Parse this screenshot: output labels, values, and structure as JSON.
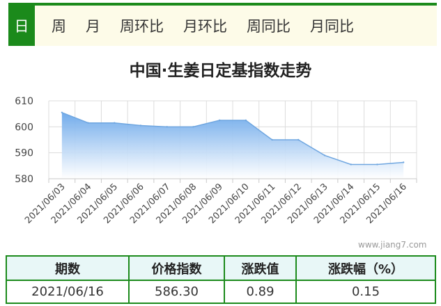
{
  "tabs": [
    "日",
    "周",
    "月",
    "周环比",
    "月环比",
    "周同比",
    "月同比"
  ],
  "active_tab": 0,
  "title": "中国·生姜日定基指数走势",
  "watermark": "www.jiang7.com",
  "colors": {
    "accent": "#1b8a1b",
    "line": "#6fa6e0",
    "fill_top": "#6aa7ea",
    "fill_bottom": "#ffffff"
  },
  "chart_data": {
    "type": "area",
    "title": "中国·生姜日定基指数走势",
    "xlabel": "",
    "ylabel": "",
    "categories": [
      "2021/06/03",
      "2021/06/04",
      "2021/06/05",
      "2021/06/06",
      "2021/06/07",
      "2021/06/08",
      "2021/06/09",
      "2021/06/10",
      "2021/06/11",
      "2021/06/12",
      "2021/06/13",
      "2021/06/14",
      "2021/06/15",
      "2021/06/16"
    ],
    "series": [
      {
        "values": [
          605.5,
          601.5,
          601.5,
          600.5,
          600.0,
          600.0,
          602.5,
          602.5,
          595.0,
          595.0,
          589.0,
          585.5,
          585.5,
          586.3
        ]
      }
    ],
    "yticks": [
      580,
      590,
      600,
      610
    ],
    "ylim": [
      580,
      610
    ],
    "grid": true
  },
  "table": {
    "headers": [
      "期数",
      "价格指数",
      "涨跌值",
      "涨跌幅（%）"
    ],
    "row": [
      "2021/06/16",
      "586.30",
      "0.89",
      "0.15"
    ]
  }
}
